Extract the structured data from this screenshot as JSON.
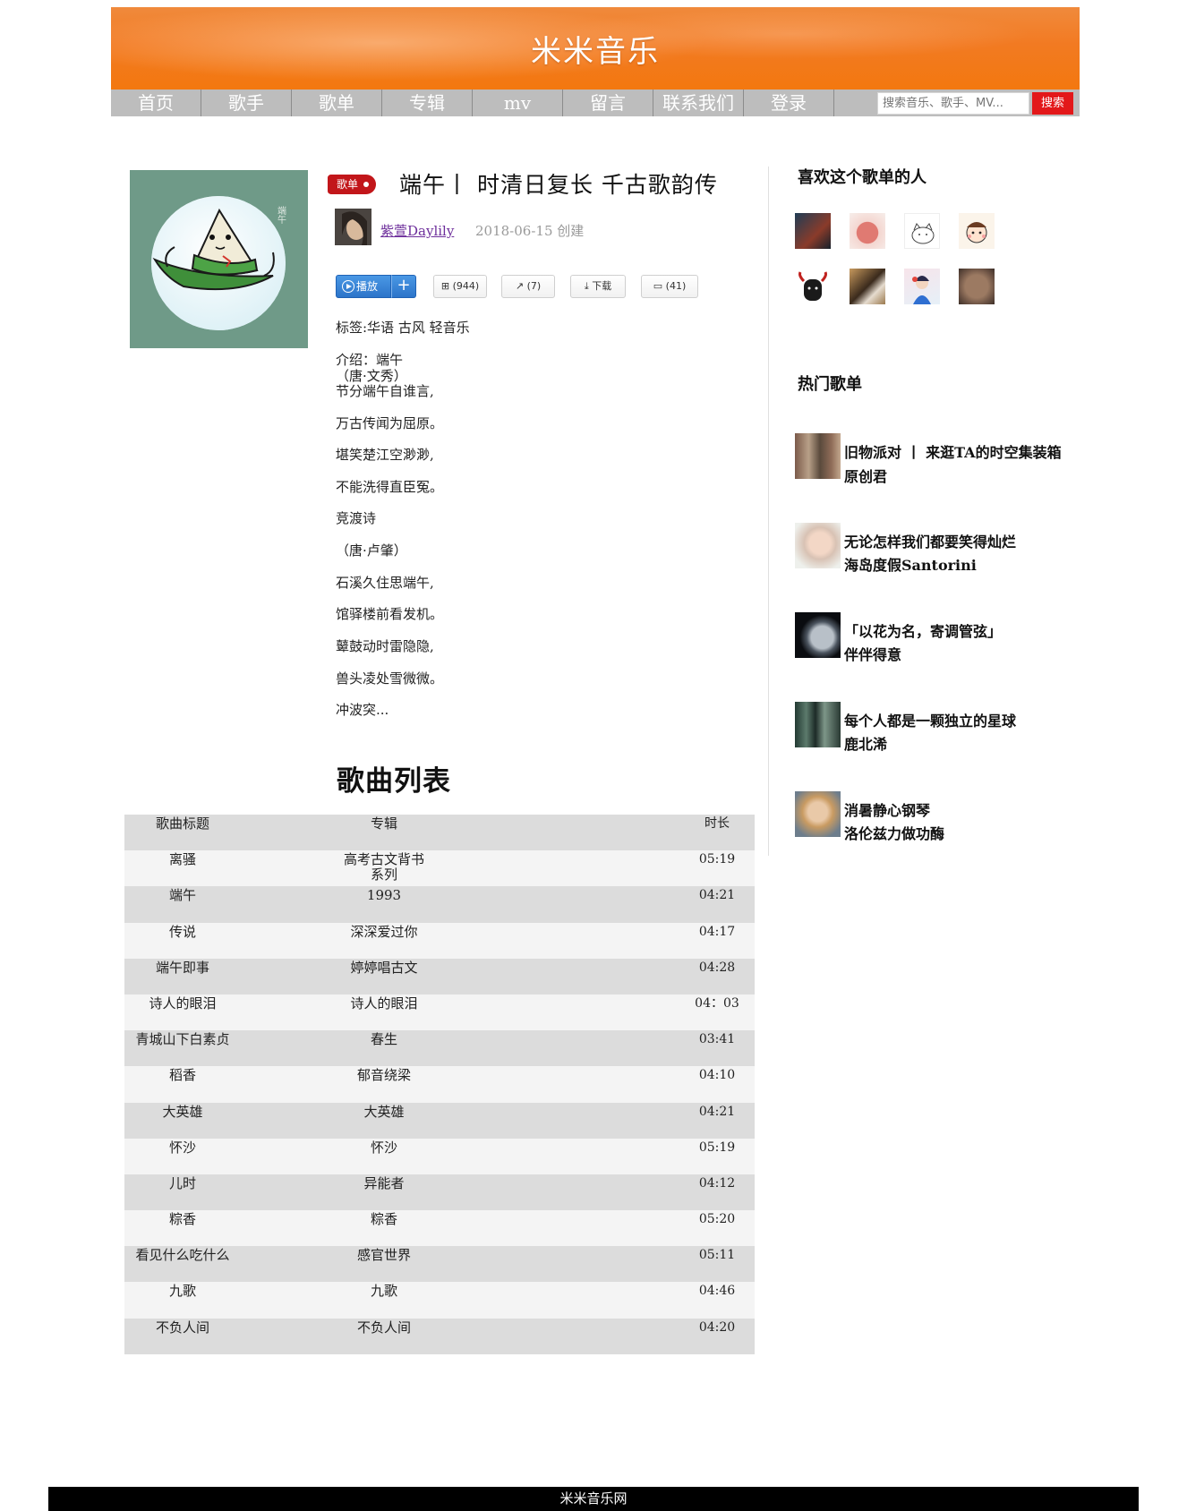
{
  "site": {
    "title": "米米音乐"
  },
  "nav": {
    "items": [
      "首页",
      "歌手",
      "歌单",
      "专辑",
      "mv",
      "留言",
      "联系我们",
      "登录"
    ],
    "search_placeholder": "搜索音乐、歌手、MV...",
    "search_button": "搜索"
  },
  "playlist": {
    "badge": "歌单",
    "title": "端午丨 时清日复长 千古歌韵传",
    "creator": "紫萱Daylily",
    "created": "2018-06-15 创建",
    "actions": {
      "play": "播放",
      "add": "+",
      "collect": "(944)",
      "share": "(7)",
      "download": "下载",
      "comment": "(41)"
    },
    "tags": "标签:华语 古风 轻音乐",
    "intro_lines": [
      "介绍：端午",
      "（唐·文秀）",
      "节分端午自谁言,",
      "万古传闻为屈原。",
      "堪笑楚江空渺渺,",
      "不能洗得直臣冤。",
      "竞渡诗",
      "（唐·卢肇）",
      "石溪久住思端午,",
      "馆驿楼前看发机。",
      "鼙鼓动时雷隐隐,",
      "兽头凌处雪微微。",
      "冲波突..."
    ]
  },
  "songs": {
    "heading": "歌曲列表",
    "headers": {
      "title": "歌曲标题",
      "album": "专辑",
      "duration": "时长"
    },
    "rows": [
      {
        "title": "离骚",
        "album": "高考古文背书系列",
        "duration": "05:19"
      },
      {
        "title": "端午",
        "album": "1993",
        "duration": "04:21"
      },
      {
        "title": "传说",
        "album": "深深爱过你",
        "duration": "04:17"
      },
      {
        "title": "端午即事",
        "album": "婷婷唱古文",
        "duration": "04:28"
      },
      {
        "title": "诗人的眼泪",
        "album": "诗人的眼泪",
        "duration": "04：03"
      },
      {
        "title": "青城山下白素贞",
        "album": "春生",
        "duration": "03:41"
      },
      {
        "title": "稻香",
        "album": "郁音绕梁",
        "duration": "04:10"
      },
      {
        "title": "大英雄",
        "album": "大英雄",
        "duration": "04:21"
      },
      {
        "title": "怀沙",
        "album": "怀沙",
        "duration": "05:19"
      },
      {
        "title": "儿时",
        "album": "异能者",
        "duration": "04:12"
      },
      {
        "title": "粽香",
        "album": "粽香",
        "duration": "05:20"
      },
      {
        "title": "看见什么吃什么",
        "album": "感官世界",
        "duration": "05:11"
      },
      {
        "title": "九歌",
        "album": "九歌",
        "duration": "04:46"
      },
      {
        "title": "不负人间",
        "album": "不负人间",
        "duration": "04:20"
      }
    ]
  },
  "sidebar": {
    "fans_heading": "喜欢这个歌单的人",
    "hot_heading": "热门歌单",
    "hot": [
      {
        "name": "旧物派对 丨 来逛TA的时空集装箱",
        "author": "原创君"
      },
      {
        "name": "无论怎样我们都要笑得灿烂",
        "author": "海岛度假Santorini"
      },
      {
        "name": "「以花为名，寄调管弦」",
        "author": "伴伴得意"
      },
      {
        "name": "每个人都是一颗独立的星球",
        "author": "鹿北浠"
      },
      {
        "name": "消暑静心钢琴",
        "author": "洛伦兹力做功酶"
      }
    ]
  },
  "footer": {
    "text": "米米音乐网"
  },
  "colors": {
    "header": "#f27a22",
    "nav": "#bdbdbd",
    "badge": "#c2161a",
    "search_button": "#e3181a",
    "play_button": "#2c74c9",
    "creator_link": "#6d2e9b"
  }
}
